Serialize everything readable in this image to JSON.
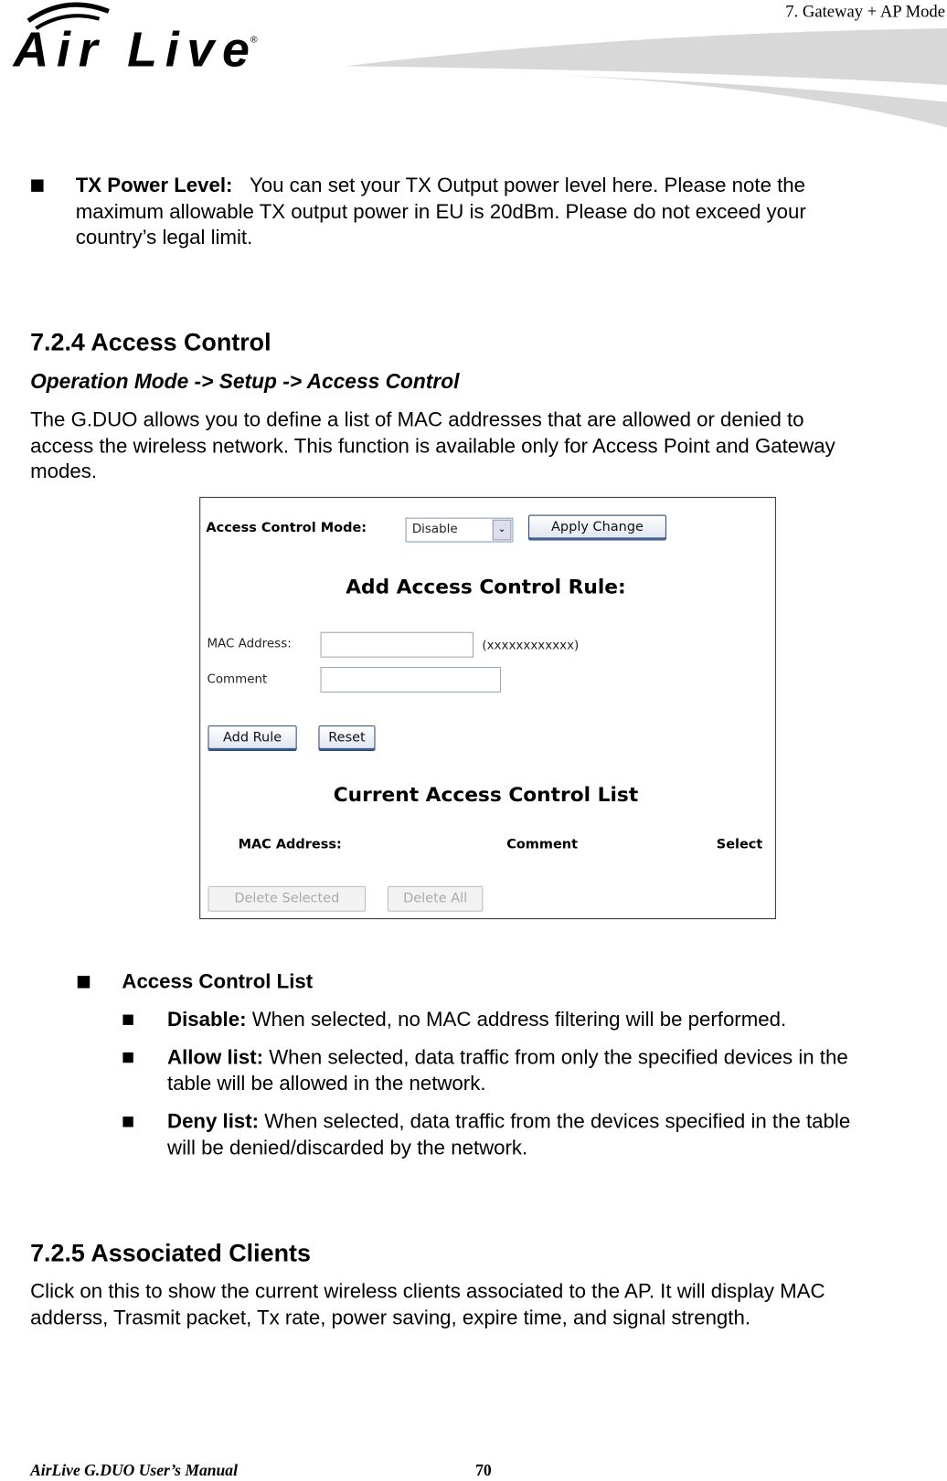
{
  "header": {
    "chapter": "7. Gateway + AP Mode",
    "logo_text": "Air Live"
  },
  "tx_power": {
    "label": "TX Power Level:",
    "lines": [
      "You can set your TX Output power level here.    Please note the",
      "maximum allowable TX output power in EU is 20dBm.    Please do not exceed your",
      "country’s legal limit."
    ]
  },
  "section_724": {
    "title": "7.2.4 Access Control",
    "path": "Operation Mode -> Setup -> Access Control",
    "lines": [
      "The G.DUO allows you to define a list of MAC addresses that are allowed or denied to",
      "access the wireless network.    This function is available only for Access Point and Gateway",
      "modes."
    ]
  },
  "screenshot": {
    "mode_label": "Access Control Mode:",
    "mode_value": "Disable",
    "apply_label": "Apply Change",
    "add_title": "Add Access Control Rule:",
    "mac_label": "MAC Address:",
    "mac_hint": "(xxxxxxxxxxxx)",
    "comment_label": "Comment",
    "add_rule_label": "Add Rule",
    "reset_label": "Reset",
    "list_title": "Current Access Control List",
    "columns": [
      "MAC Address:",
      "Comment",
      "Select"
    ],
    "delete_selected_label": "Delete Selected",
    "delete_all_label": "Delete All"
  },
  "acl": {
    "title": "Access Control List",
    "items": [
      {
        "term": "Disable:",
        "lines": [
          "When selected, no MAC address filtering will be performed."
        ]
      },
      {
        "term": "Allow list:",
        "lines": [
          "When selected, data traffic from only the specified devices in the",
          "table will be allowed in the network."
        ]
      },
      {
        "term": "Deny list:",
        "lines": [
          "When selected, data traffic from the devices specified in the table",
          "will be denied/discarded by the network."
        ]
      }
    ]
  },
  "section_725": {
    "title": "7.2.5 Associated Clients",
    "lines": [
      "Click on this to show the current wireless clients associated to the AP.    It will display MAC",
      "adderss, Trasmit packet, Tx rate, power saving, expire time, and signal strength."
    ]
  },
  "footer": {
    "manual": "AirLive G.DUO User’s Manual",
    "page": "70"
  }
}
